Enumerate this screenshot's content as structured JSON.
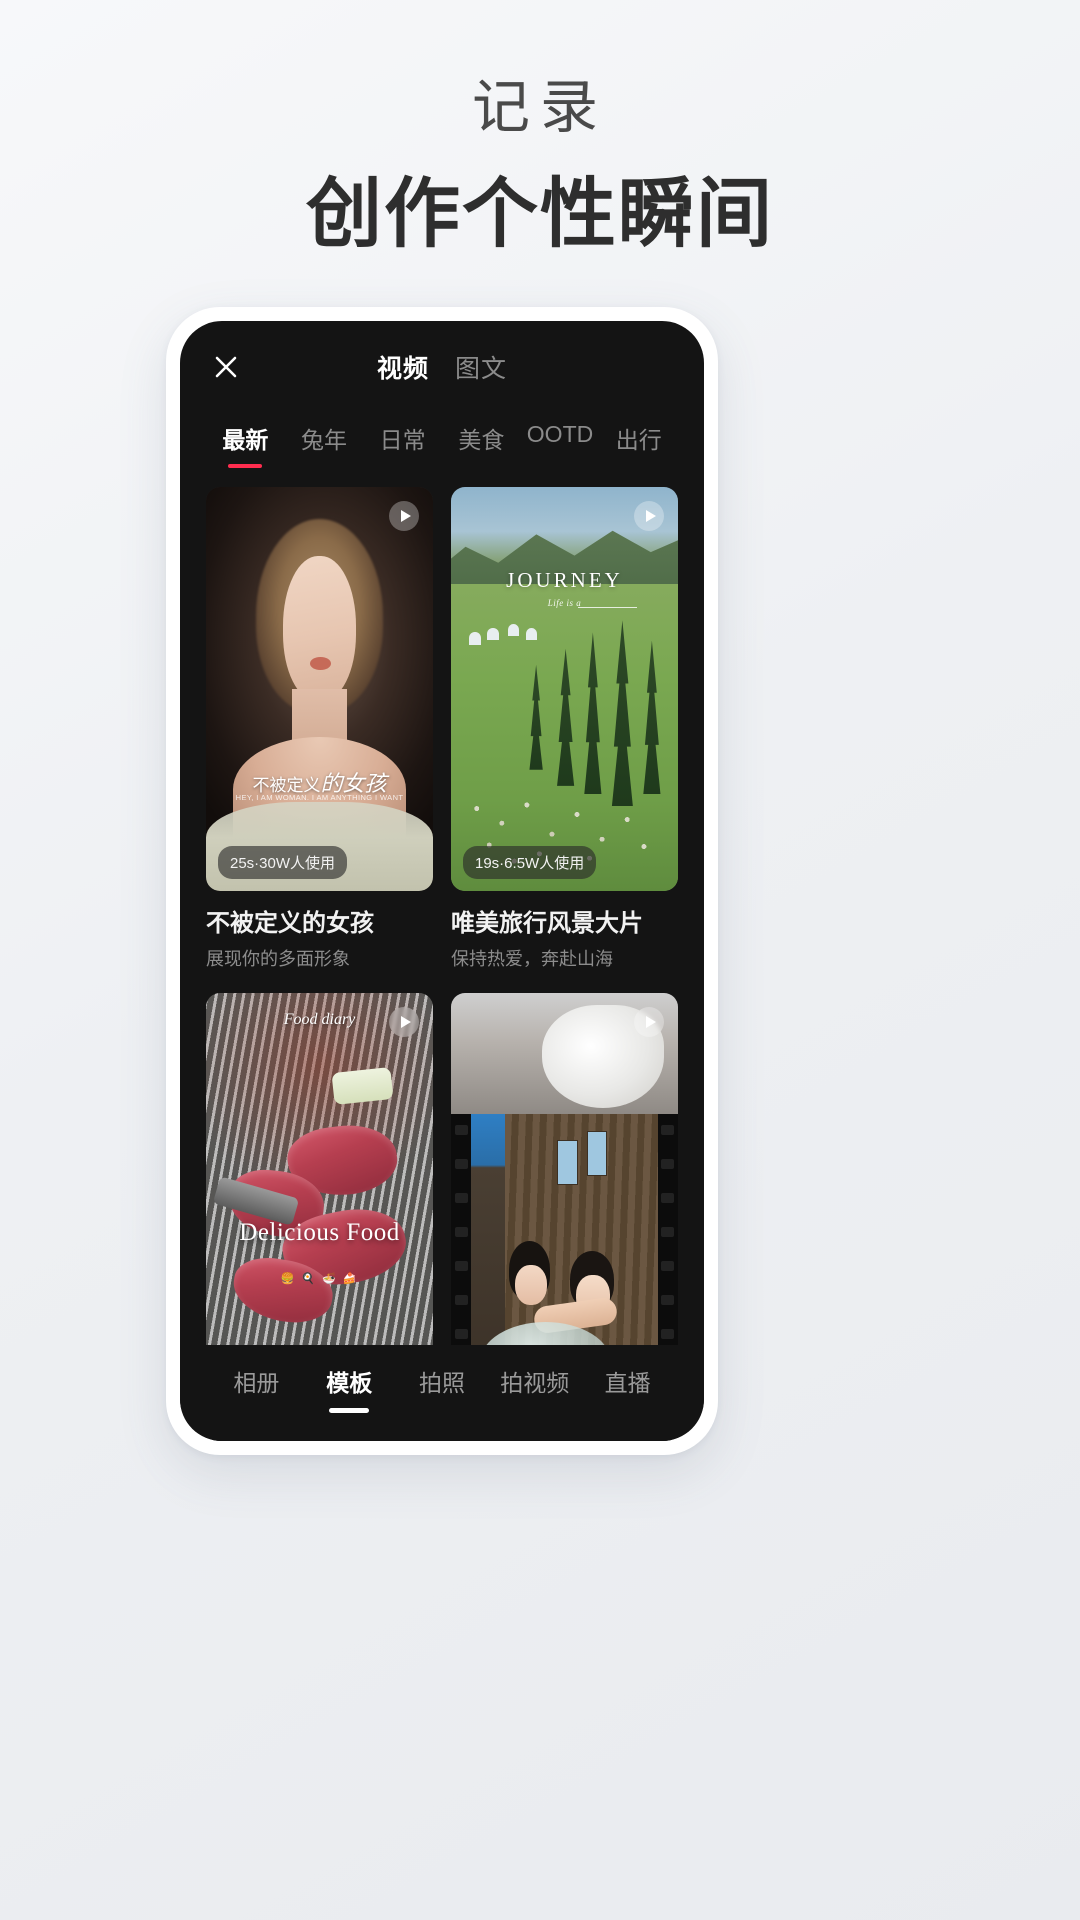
{
  "promo": {
    "subline": "记录",
    "headline": "创作个性瞬间"
  },
  "colors": {
    "accent": "#ff2d4f",
    "screen_bg": "#141414",
    "phone_body": "#ffffff",
    "text_primary": "#f2f2f2",
    "text_muted": "#8b8b8b"
  },
  "app": {
    "header": {
      "close_icon": "close-icon",
      "mode_tabs": [
        {
          "label": "视频",
          "active": true
        },
        {
          "label": "图文",
          "active": false
        }
      ]
    },
    "category_chips": [
      {
        "label": "最新",
        "active": true
      },
      {
        "label": "兔年",
        "active": false
      },
      {
        "label": "日常",
        "active": false
      },
      {
        "label": "美食",
        "active": false
      },
      {
        "label": "OOTD",
        "active": false
      },
      {
        "label": "出行",
        "active": false
      }
    ],
    "templates": [
      {
        "title": "不被定义的女孩",
        "subtitle": "展现你的多面形象",
        "badge": "25s·30W人使用",
        "play_icon": "play-icon",
        "overlay_cn": "不被定义",
        "overlay_cn_italic": "的女孩",
        "overlay_en": "HEY, I AM WOMAN. I AM ANYTHING I WANT"
      },
      {
        "title": "唯美旅行风景大片",
        "subtitle": "保持热爱，奔赴山海",
        "badge": "19s·6.5W人使用",
        "play_icon": "play-icon",
        "overlay_title": "JOURNEY",
        "overlay_sub": "Life is a"
      },
      {
        "title": "",
        "subtitle": "",
        "badge": "",
        "play_icon": "play-icon",
        "overlay_top": "Food diary",
        "overlay_main": "Delicious Food",
        "overlay_emoji": "🍔 🍳 🍜 🍰"
      },
      {
        "title": "",
        "subtitle": "",
        "badge": "",
        "play_icon": "play-icon"
      }
    ],
    "bottom_nav": [
      {
        "label": "相册",
        "active": false
      },
      {
        "label": "模板",
        "active": true
      },
      {
        "label": "拍照",
        "active": false
      },
      {
        "label": "拍视频",
        "active": false
      },
      {
        "label": "直播",
        "active": false
      }
    ]
  }
}
